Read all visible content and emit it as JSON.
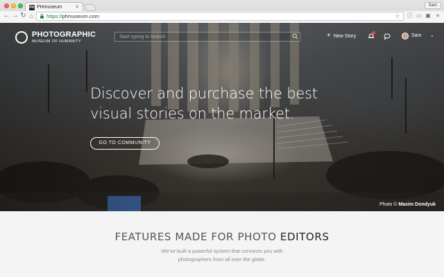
{
  "browser": {
    "tab_title": "PHmuseum",
    "tab_favicon": "PH",
    "profile_name": "Sam",
    "url_scheme": "https://",
    "url_host": "phmuseum.com"
  },
  "site": {
    "logo_line1": "PHOTOGRAPHIC",
    "logo_line2": "MUSEUM OF HUMANITY",
    "search_placeholder": "Start typing to search",
    "new_story": "New Story",
    "user_name": "Sam",
    "headline": "Discover and purchase the best visual stories on the market.",
    "cta": "GO TO COMMUNITY",
    "credit_prefix": "Photo ©",
    "credit_author": "Maxim Dondyuk"
  },
  "features": {
    "title_light": "FEATURES MADE FOR PHOTO",
    "title_strong": "EDITORS",
    "subtitle_line1": "We've built a powerful system that connects you with",
    "subtitle_line2": "photographers from all over the globe."
  },
  "colors": {
    "secure_green": "#0b8043",
    "notification_red": "#e04a4a",
    "features_bg": "#f4f4f4"
  },
  "icons": [
    "back-arrow-icon",
    "forward-arrow-icon",
    "reload-icon",
    "home-icon",
    "lock-icon",
    "star-icon",
    "search-icon",
    "bell-icon",
    "chat-icon",
    "chevron-down-icon"
  ]
}
